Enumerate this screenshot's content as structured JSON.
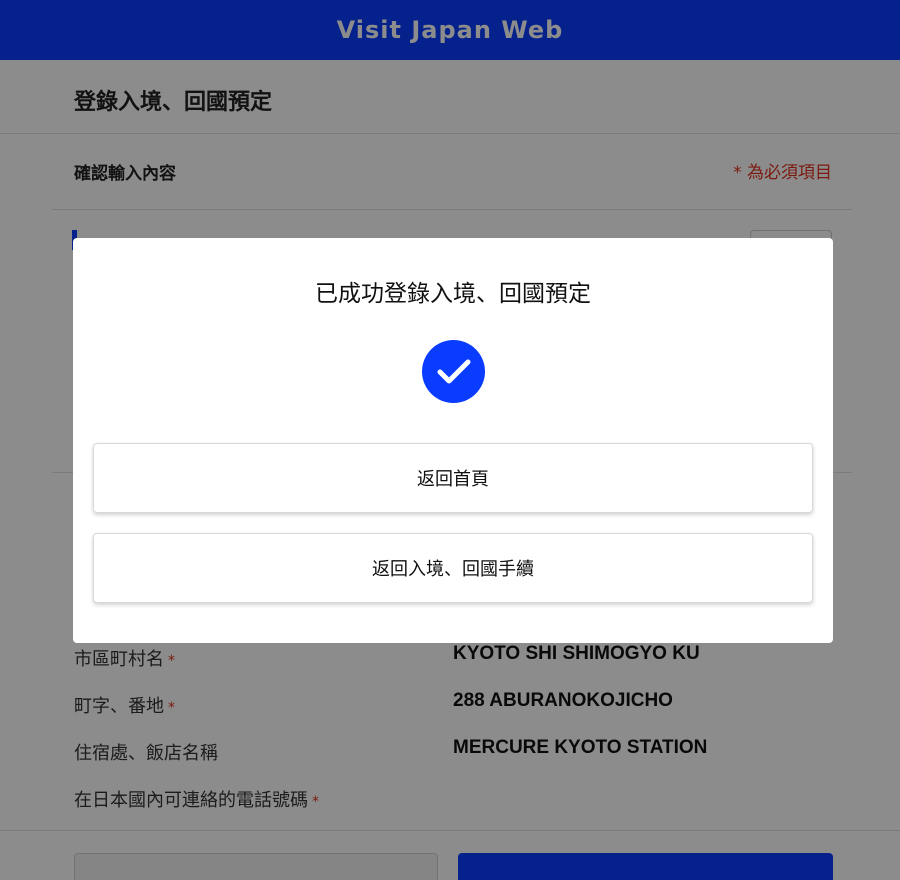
{
  "header": {
    "brand": "Visit Japan Web"
  },
  "page": {
    "title": "登錄入境、回國預定"
  },
  "confirm": {
    "title": "確認輸入內容",
    "required_note": "* 為必須項目"
  },
  "info_rows": [
    {
      "label": "市區町村名",
      "required": "*",
      "value": "KYOTO SHI SHIMOGYO KU"
    },
    {
      "label": "町字、番地",
      "required": "*",
      "value": "288 ABURANOKOJICHO"
    },
    {
      "label": "住宿處、飯店名稱",
      "required": "",
      "value": "MERCURE KYOTO STATION"
    },
    {
      "label": "在日本國內可連絡的電話號碼",
      "required": "*",
      "value": ""
    }
  ],
  "modal": {
    "title": "已成功登錄入境、回國預定",
    "icon": "check-circle-icon",
    "buttons": {
      "home": "返回首頁",
      "procedures": "返回入境、回國手續"
    }
  },
  "colors": {
    "brand_blue": "#0a3cff",
    "required_red": "#e0301e"
  }
}
